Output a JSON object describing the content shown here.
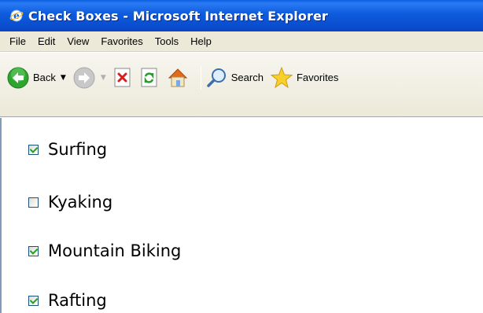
{
  "window": {
    "title": "Check Boxes - Microsoft Internet Explorer",
    "title_icon": "ie-icon"
  },
  "menu": {
    "items": [
      "File",
      "Edit",
      "View",
      "Favorites",
      "Tools",
      "Help"
    ]
  },
  "toolbar": {
    "back_label": "Back",
    "search_label": "Search",
    "favorites_label": "Favorites",
    "icons": [
      "back-arrow-icon",
      "forward-arrow-icon",
      "stop-icon",
      "refresh-icon",
      "home-icon",
      "search-icon",
      "favorites-star-icon"
    ]
  },
  "checkboxes": [
    {
      "label": "Surfing",
      "checked": true
    },
    {
      "label": "Kyaking",
      "checked": false
    },
    {
      "label": "Mountain Biking",
      "checked": true
    },
    {
      "label": "Rafting",
      "checked": true
    }
  ],
  "colors": {
    "titlebar": "#0a5fe0",
    "chrome": "#ece9d8",
    "check": "#21a121"
  }
}
